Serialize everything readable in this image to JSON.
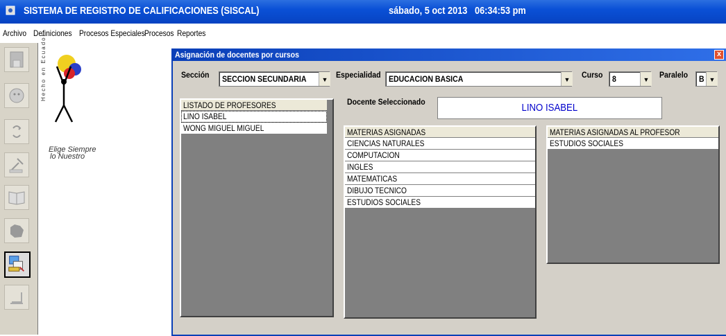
{
  "titlebar": {
    "title": "SISTEMA DE REGISTRO DE CALIFICACIONES  (SISCAL)",
    "date": "sábado, 5 oct 2013",
    "time": "06:34:53 pm"
  },
  "menu": [
    "Archivo",
    "Definiciones",
    "Procesos Especiales",
    "Procesos",
    "Reportes"
  ],
  "logo": {
    "slogan_line1": "Elige Siempre",
    "slogan_line2": "lo Nuestro",
    "vertical_text": "Hecho en Ecuador"
  },
  "sidebar_icons": [
    "save-icon",
    "user-face-icon",
    "refresh-icon",
    "tools-icon",
    "book-icon",
    "map-icon",
    "assign-teachers-icon",
    "exit-icon"
  ],
  "window": {
    "caption": "Asignación de docentes por cursos",
    "close_label": "x",
    "seccion_label": "Sección",
    "seccion_value": "SECCION SECUNDARIA",
    "especialidad_label": "Especialidad",
    "especialidad_value": "EDUCACION BASICA",
    "curso_label": "Curso",
    "curso_value": "8",
    "paralelo_label": "Paralelo",
    "paralelo_value": "B",
    "docente_label": "Docente Seleccionado",
    "docente_value": "LINO ISABEL"
  },
  "profesores": {
    "header": "LISTADO DE PROFESORES",
    "rows": [
      "LINO ISABEL",
      "WONG MIGUEL MIGUEL"
    ]
  },
  "materias": {
    "header": "MATERIAS ASIGNADAS",
    "rows": [
      "CIENCIAS NATURALES",
      "COMPUTACION",
      "INGLES",
      "MATEMATICAS",
      "DIBUJO TECNICO",
      "ESTUDIOS SOCIALES"
    ]
  },
  "materias_profesor": {
    "header": "MATERIAS ASIGNADAS AL PROFESOR",
    "rows": [
      "ESTUDIOS SOCIALES"
    ]
  }
}
